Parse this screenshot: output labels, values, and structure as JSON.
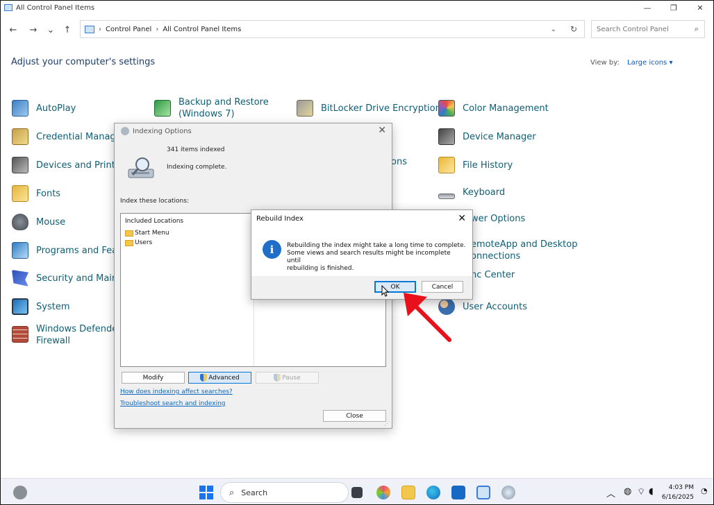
{
  "window": {
    "title": "All Control Panel Items",
    "controls": [
      "—",
      "❐",
      "✕"
    ]
  },
  "nav": {
    "back": "←",
    "forward": "→",
    "recent": "⌄",
    "up": "↑"
  },
  "address": {
    "crumbs": [
      "Control Panel",
      "All Control Panel Items"
    ],
    "separator": "›",
    "dropdown": "⌄",
    "refresh": "↻"
  },
  "search": {
    "placeholder": "Search Control Panel",
    "icon": "search-icon"
  },
  "header": {
    "title": "Adjust your computer's settings",
    "view_by_label": "View by:",
    "view_by_value": "Large icons ▾"
  },
  "items": {
    "autoplay": "AutoPlay",
    "backup_1": "Backup and Restore",
    "backup_2": "(Windows 7)",
    "bitlocker": "BitLocker Drive Encryption",
    "color": "Color Management",
    "credential": "Credential Manager",
    "device_manager": "Device Manager",
    "devices": "Devices and Printers",
    "ons": "ons",
    "file_history": "File History",
    "fonts": "Fonts",
    "keyboard": "Keyboard",
    "mouse": "Mouse",
    "power": "wer Options",
    "programs": "Programs and Featu",
    "remote_1": "emoteApp and Desktop",
    "remote_2": "onnections",
    "security": "Security and Mainte",
    "sync": "nc Center",
    "system": "System",
    "user_accounts": "User Accounts",
    "defender_1": "Windows Defender",
    "defender_2": "Firewall"
  },
  "indexing": {
    "title": "Indexing Options",
    "close": "✕",
    "count": "341 items indexed",
    "status": "Indexing complete.",
    "locations_label": "Index these locations:",
    "list_header": "Included Locations",
    "locations": [
      "Start Menu",
      "Users"
    ],
    "modify": "Modify",
    "advanced": "Advanced",
    "pause": "Pause",
    "link1": "How does indexing affect searches?",
    "link2": "Troubleshoot search and indexing",
    "close_btn": "Close"
  },
  "rebuild": {
    "title": "Rebuild Index",
    "close": "✕",
    "icon": "i",
    "message_1": "Rebuilding the index might take a long time to complete.",
    "message_2": "Some views and search results might be incomplete until",
    "message_3": "rebuilding is finished.",
    "ok": "OK",
    "cancel": "Cancel"
  },
  "taskbar": {
    "search": "Search",
    "time": "4:03 PM",
    "date": "6/16/2025",
    "tray_chevron": "︿"
  },
  "colors": {
    "link": "#0e5e75",
    "accent": "#0078d4",
    "arrow": "#e8101a"
  }
}
